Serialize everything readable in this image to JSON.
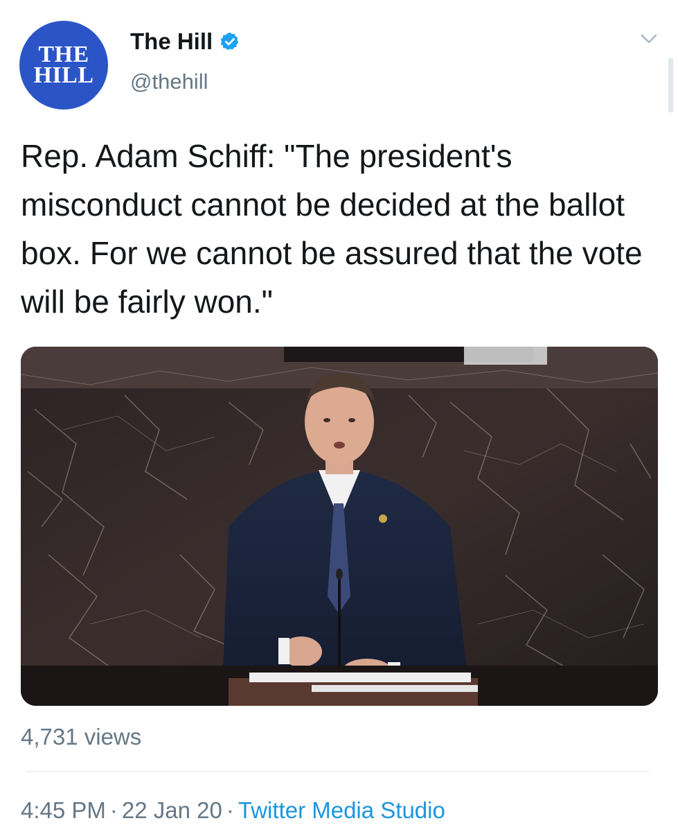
{
  "account": {
    "display_name": "The Hill",
    "handle": "@thehill",
    "avatar_logo_lines": [
      "THE",
      "HILL"
    ],
    "verified": true
  },
  "tweet": {
    "text": "Rep. Adam Schiff: \"The president's misconduct cannot be decided at the ballot box. For we cannot be assured that the vote will be fairly won.\"",
    "media_type": "video",
    "views": "4,731 views",
    "time": "4:45 PM",
    "date": "22 Jan 20",
    "separator": "·",
    "source": "Twitter Media Studio"
  },
  "icons": {
    "verified": "verified-badge-icon",
    "menu": "chevron-down-icon"
  },
  "colors": {
    "avatar_bg": "#2b55c7",
    "verified_blue": "#1da1f2",
    "link_blue": "#1b95e0",
    "secondary_text": "#657786",
    "primary_text": "#14171a"
  }
}
